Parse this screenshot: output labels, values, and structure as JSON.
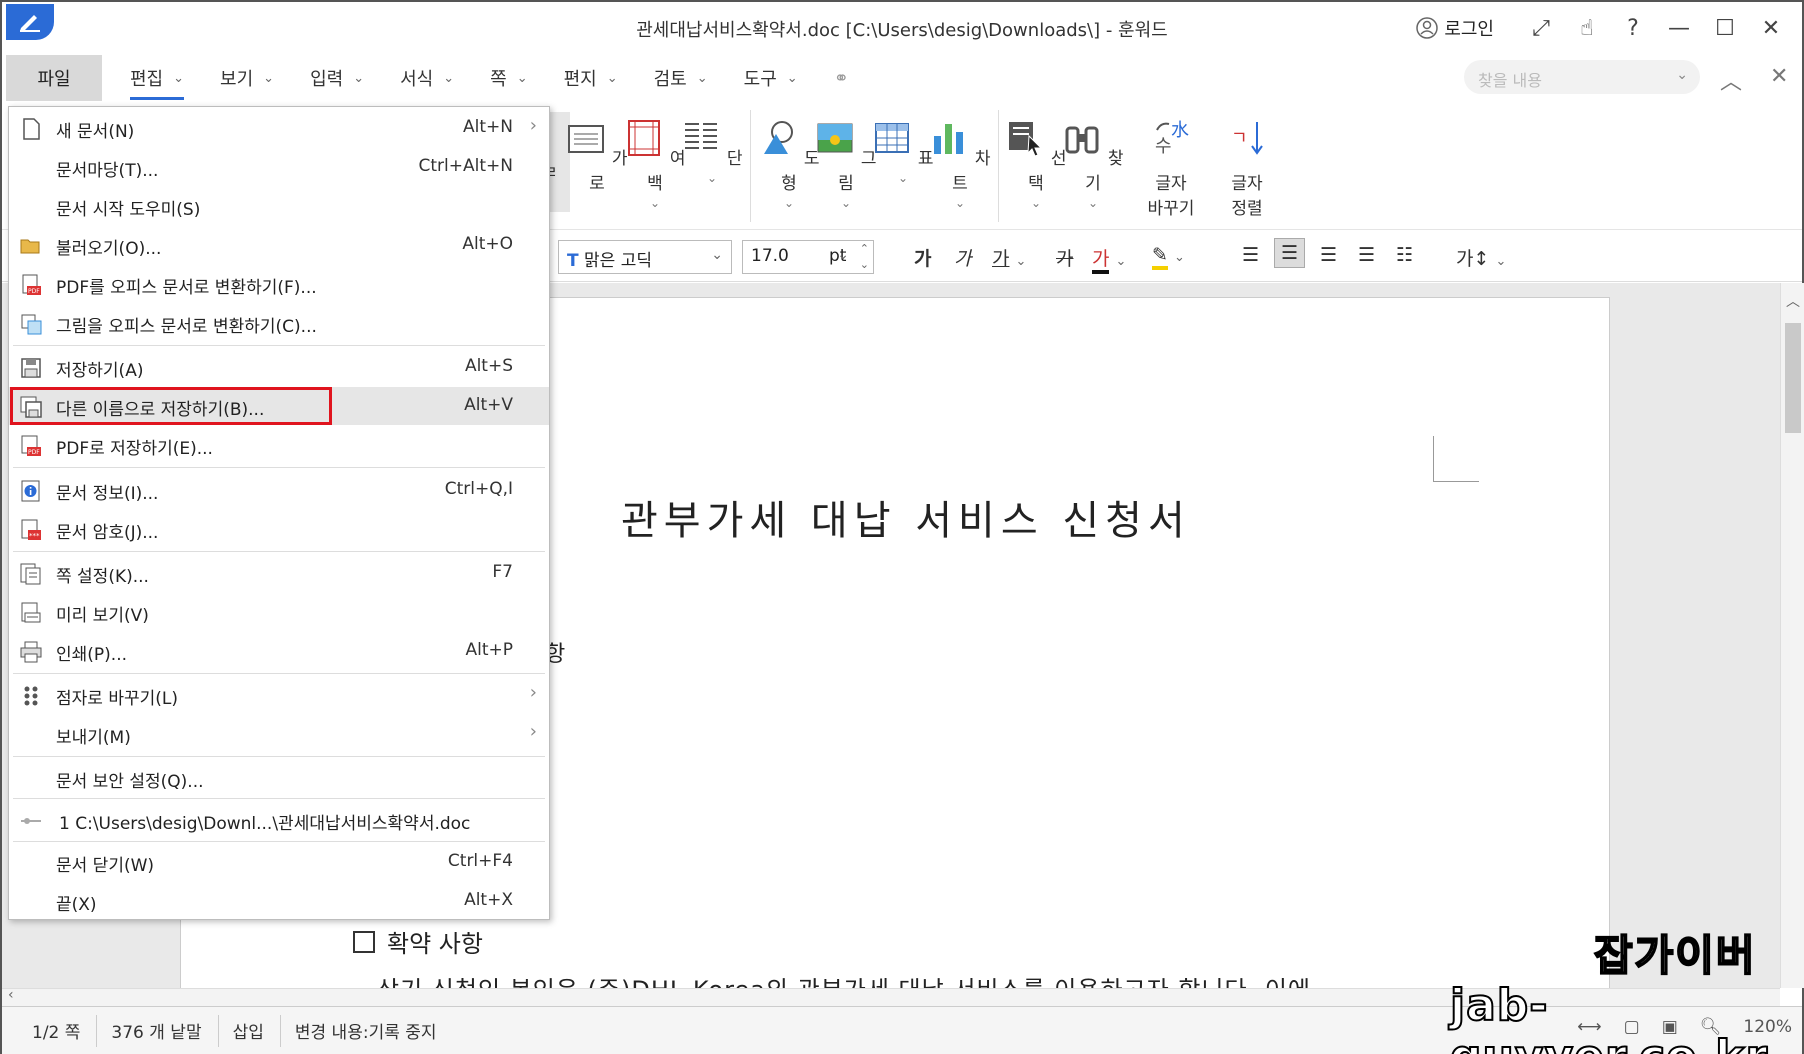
{
  "window": {
    "title": "관세대납서비스확약서.doc [C:\\Users\\desig\\Downloads\\] - 훈워드",
    "login_label": "로그인",
    "help_label": "?"
  },
  "menubar": {
    "file_tab": "파일",
    "items": [
      "편집",
      "보기",
      "입력",
      "서식",
      "쪽",
      "편지",
      "검토",
      "도구"
    ],
    "find_placeholder": "찾을 내용"
  },
  "ribbon": {
    "buttons": [
      {
        "label": "가로",
        "icon": "page-landscape-icon"
      },
      {
        "label": "여백",
        "icon": "margin-icon"
      },
      {
        "label": "단",
        "icon": "columns-icon"
      },
      {
        "label": "도형",
        "icon": "shape-icon"
      },
      {
        "label": "그림",
        "icon": "picture-icon"
      },
      {
        "label": "표",
        "icon": "table-icon"
      },
      {
        "label": "차트",
        "icon": "chart-icon"
      },
      {
        "label": "선택",
        "icon": "select-icon"
      },
      {
        "label": "찾기",
        "icon": "binoculars-icon"
      },
      {
        "label": "글자\n바꾸기",
        "icon": "replace-text-icon"
      },
      {
        "label": "글자\n정렬",
        "icon": "sort-text-icon"
      }
    ],
    "partial_label": "ㄹ"
  },
  "formatbar": {
    "font": "맑은 고딕",
    "size": "17.0",
    "unit": "pt",
    "bold": "가",
    "italic": "가",
    "underline": "가",
    "strike": "가",
    "color_text": "가",
    "spacing": "가"
  },
  "document": {
    "title": "관부가세 대납 서비스 신청서",
    "fragment": "항",
    "heading": "확약 사항",
    "line": "상기 신청인 본인은 (주)DHL Korea의 관부가세 대납 서비스를 이용하고자 합니다. 이에"
  },
  "file_menu": {
    "items": [
      {
        "label": "새 문서(N)",
        "shortcut": "Alt+N",
        "arrow": "›",
        "icon": "new-document-icon"
      },
      {
        "label": "문서마당(T)...",
        "shortcut": "Ctrl+Alt+N",
        "icon": ""
      },
      {
        "label": "문서 시작 도우미(S)",
        "shortcut": "",
        "icon": ""
      },
      {
        "label": "불러오기(O)...",
        "shortcut": "Alt+O",
        "icon": "folder-open-icon"
      },
      {
        "label": "PDF를 오피스 문서로 변환하기(F)...",
        "shortcut": "",
        "icon": "pdf-convert-icon"
      },
      {
        "label": "그림을 오피스 문서로 변환하기(C)...",
        "shortcut": "",
        "icon": "image-convert-icon"
      },
      {
        "label": "저장하기(A)",
        "shortcut": "Alt+S",
        "icon": "save-icon"
      },
      {
        "label": "다른 이름으로 저장하기(B)...",
        "shortcut": "Alt+V",
        "icon": "save-as-icon"
      },
      {
        "label": "PDF로 저장하기(E)...",
        "shortcut": "",
        "icon": "pdf-save-icon"
      },
      {
        "label": "문서 정보(I)...",
        "shortcut": "Ctrl+Q,I",
        "icon": "info-icon"
      },
      {
        "label": "문서 암호(J)...",
        "shortcut": "",
        "icon": "password-icon"
      },
      {
        "label": "쪽 설정(K)...",
        "shortcut": "F7",
        "icon": "page-setup-icon"
      },
      {
        "label": "미리 보기(V)",
        "shortcut": "",
        "icon": "preview-icon"
      },
      {
        "label": "인쇄(P)...",
        "shortcut": "Alt+P",
        "icon": "print-icon"
      },
      {
        "label": "점자로 바꾸기(L)",
        "shortcut": "",
        "arrow": "›",
        "icon": "braille-icon"
      },
      {
        "label": "보내기(M)",
        "shortcut": "",
        "arrow": "›",
        "icon": ""
      },
      {
        "label": "문서 보안 설정(Q)...",
        "shortcut": "",
        "icon": ""
      },
      {
        "label": "1 C:\\Users\\desig\\Downl...\\관세대납서비스확약서.doc",
        "shortcut": "",
        "icon": "recent-pin-icon"
      },
      {
        "label": "문서 닫기(W)",
        "shortcut": "Ctrl+F4",
        "icon": ""
      },
      {
        "label": "끝(X)",
        "shortcut": "Alt+X",
        "icon": ""
      }
    ]
  },
  "statusbar": {
    "page": "1/2 쪽",
    "words": "376 개 낱말",
    "mode": "삽입",
    "track": "변경 내용:기록 중지",
    "zoom": "120%"
  },
  "watermark": {
    "line1": "잡가이버",
    "line2": "jab-guyver.co.kr"
  },
  "colors": {
    "accent": "#2b6bd6",
    "highlight": "#e0141e"
  }
}
